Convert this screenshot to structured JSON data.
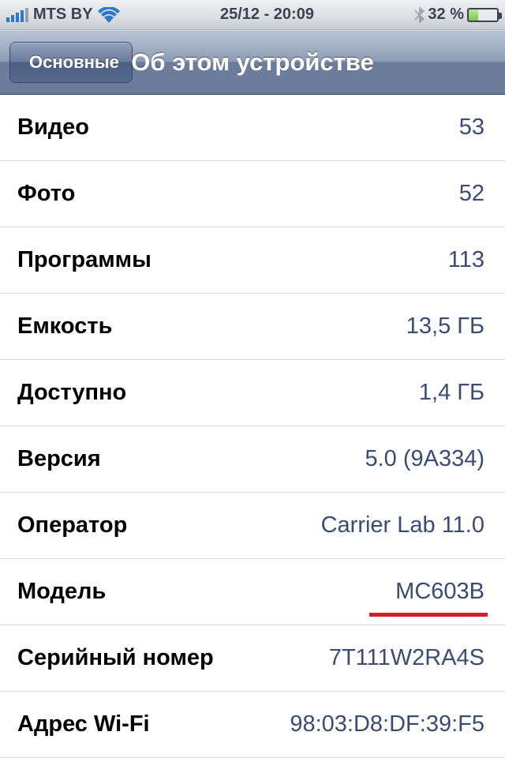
{
  "statusbar": {
    "carrier": "MTS BY",
    "datetime": "25/12 - 20:09",
    "battery_pct": "32 %"
  },
  "navbar": {
    "back_label": "Основные",
    "title": "Об этом устройстве"
  },
  "rows": [
    {
      "label": "Видео",
      "value": "53"
    },
    {
      "label": "Фото",
      "value": "52"
    },
    {
      "label": "Программы",
      "value": "113"
    },
    {
      "label": "Емкость",
      "value": "13,5 ГБ"
    },
    {
      "label": "Доступно",
      "value": "1,4 ГБ"
    },
    {
      "label": "Версия",
      "value": "5.0 (9A334)"
    },
    {
      "label": "Оператор",
      "value": "Carrier Lab 11.0"
    },
    {
      "label": "Модель",
      "value": "MC603B",
      "underlined": true
    },
    {
      "label": "Серийный номер",
      "value": "7T111W2RA4S"
    },
    {
      "label": "Адрес Wi-Fi",
      "value": "98:03:D8:DF:39:F5"
    }
  ]
}
